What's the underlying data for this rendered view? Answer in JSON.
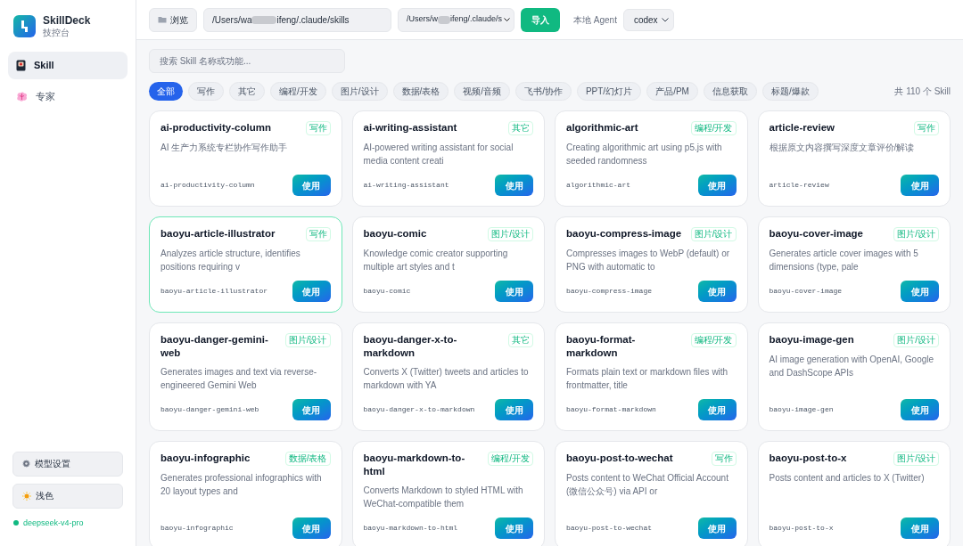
{
  "app": {
    "name": "SkillDeck",
    "subtitle": "技控台"
  },
  "sidebar": {
    "items": [
      {
        "label": "Skill",
        "selected": true
      },
      {
        "label": "专家",
        "selected": false
      }
    ],
    "bottom_buttons": [
      {
        "label": "模型设置"
      },
      {
        "label": "浅色"
      }
    ],
    "model_status": {
      "label": "deepseek-v4-pro",
      "color": "#10b981"
    }
  },
  "toolbar": {
    "browse": "浏览",
    "path_start": "/Users/wa",
    "path_end": "ifeng/.claude/skills",
    "source_start": "/Users/w",
    "source_end": "ifeng/.claude/s",
    "import": "导入",
    "agent_label": "本地 Agent",
    "agent_value": "codex"
  },
  "search": {
    "placeholder": "搜索 Skill 名称或功能..."
  },
  "filters": [
    {
      "label": "全部",
      "selected": true
    },
    {
      "label": "写作",
      "selected": false
    },
    {
      "label": "其它",
      "selected": false
    },
    {
      "label": "编程/开发",
      "selected": false
    },
    {
      "label": "图片/设计",
      "selected": false
    },
    {
      "label": "数据/表格",
      "selected": false
    },
    {
      "label": "视频/音频",
      "selected": false
    },
    {
      "label": "飞书/协作",
      "selected": false
    },
    {
      "label": "PPT/幻灯片",
      "selected": false
    },
    {
      "label": "产品/PM",
      "selected": false
    },
    {
      "label": "信息获取",
      "selected": false
    },
    {
      "label": "标题/爆款",
      "selected": false
    }
  ],
  "count": "共 110 个 Skill",
  "cards": [
    {
      "title": "ai-productivity-column",
      "tag": "写作",
      "desc": "AI 生产力系统专栏协作写作助手",
      "id": "ai-productivity-column",
      "button": "使用",
      "selected": false
    },
    {
      "title": "ai-writing-assistant",
      "tag": "其它",
      "desc": "AI-powered writing assistant for social media content creati",
      "id": "ai-writing-assistant",
      "button": "使用",
      "selected": false
    },
    {
      "title": "algorithmic-art",
      "tag": "编程/开发",
      "desc": "Creating algorithmic art using p5.js with seeded randomness",
      "id": "algorithmic-art",
      "button": "使用",
      "selected": false
    },
    {
      "title": "article-review",
      "tag": "写作",
      "desc": "根据原文内容撰写深度文章评价/解读",
      "id": "article-review",
      "button": "使用",
      "selected": false
    },
    {
      "title": "baoyu-article-illustrator",
      "tag": "写作",
      "desc": "Analyzes article structure, identifies positions requiring v",
      "id": "baoyu-article-illustrator",
      "button": "使用",
      "selected": true
    },
    {
      "title": "baoyu-comic",
      "tag": "图片/设计",
      "desc": "Knowledge comic creator supporting multiple art styles and t",
      "id": "baoyu-comic",
      "button": "使用",
      "selected": false
    },
    {
      "title": "baoyu-compress-image",
      "tag": "图片/设计",
      "desc": "Compresses images to WebP (default) or PNG with automatic to",
      "id": "baoyu-compress-image",
      "button": "使用",
      "selected": false
    },
    {
      "title": "baoyu-cover-image",
      "tag": "图片/设计",
      "desc": "Generates article cover images with 5 dimensions (type, pale",
      "id": "baoyu-cover-image",
      "button": "使用",
      "selected": false
    },
    {
      "title": "baoyu-danger-gemini-web",
      "tag": "图片/设计",
      "desc": "Generates images and text via reverse-engineered Gemini Web",
      "id": "baoyu-danger-gemini-web",
      "button": "使用",
      "selected": false
    },
    {
      "title": "baoyu-danger-x-to-markdown",
      "tag": "其它",
      "desc": "Converts X (Twitter) tweets and articles to markdown with YA",
      "id": "baoyu-danger-x-to-markdown",
      "button": "使用",
      "selected": false
    },
    {
      "title": "baoyu-format-markdown",
      "tag": "编程/开发",
      "desc": "Formats plain text or markdown files with frontmatter, title",
      "id": "baoyu-format-markdown",
      "button": "使用",
      "selected": false
    },
    {
      "title": "baoyu-image-gen",
      "tag": "图片/设计",
      "desc": "AI image generation with OpenAI, Google and DashScope APIs",
      "id": "baoyu-image-gen",
      "button": "使用",
      "selected": false
    },
    {
      "title": "baoyu-infographic",
      "tag": "数据/表格",
      "desc": "Generates professional infographics with 20 layout types and",
      "id": "baoyu-infographic",
      "button": "使用",
      "selected": false
    },
    {
      "title": "baoyu-markdown-to-html",
      "tag": "编程/开发",
      "desc": "Converts Markdown to styled HTML with WeChat-compatible them",
      "id": "baoyu-markdown-to-html",
      "button": "使用",
      "selected": false
    },
    {
      "title": "baoyu-post-to-wechat",
      "tag": "写作",
      "desc": "Posts content to WeChat Official Account (微信公众号) via API or",
      "id": "baoyu-post-to-wechat",
      "button": "使用",
      "selected": false
    },
    {
      "title": "baoyu-post-to-x",
      "tag": "图片/设计",
      "desc": "Posts content and articles to X (Twitter)",
      "id": "baoyu-post-to-x",
      "button": "使用",
      "selected": false
    }
  ]
}
